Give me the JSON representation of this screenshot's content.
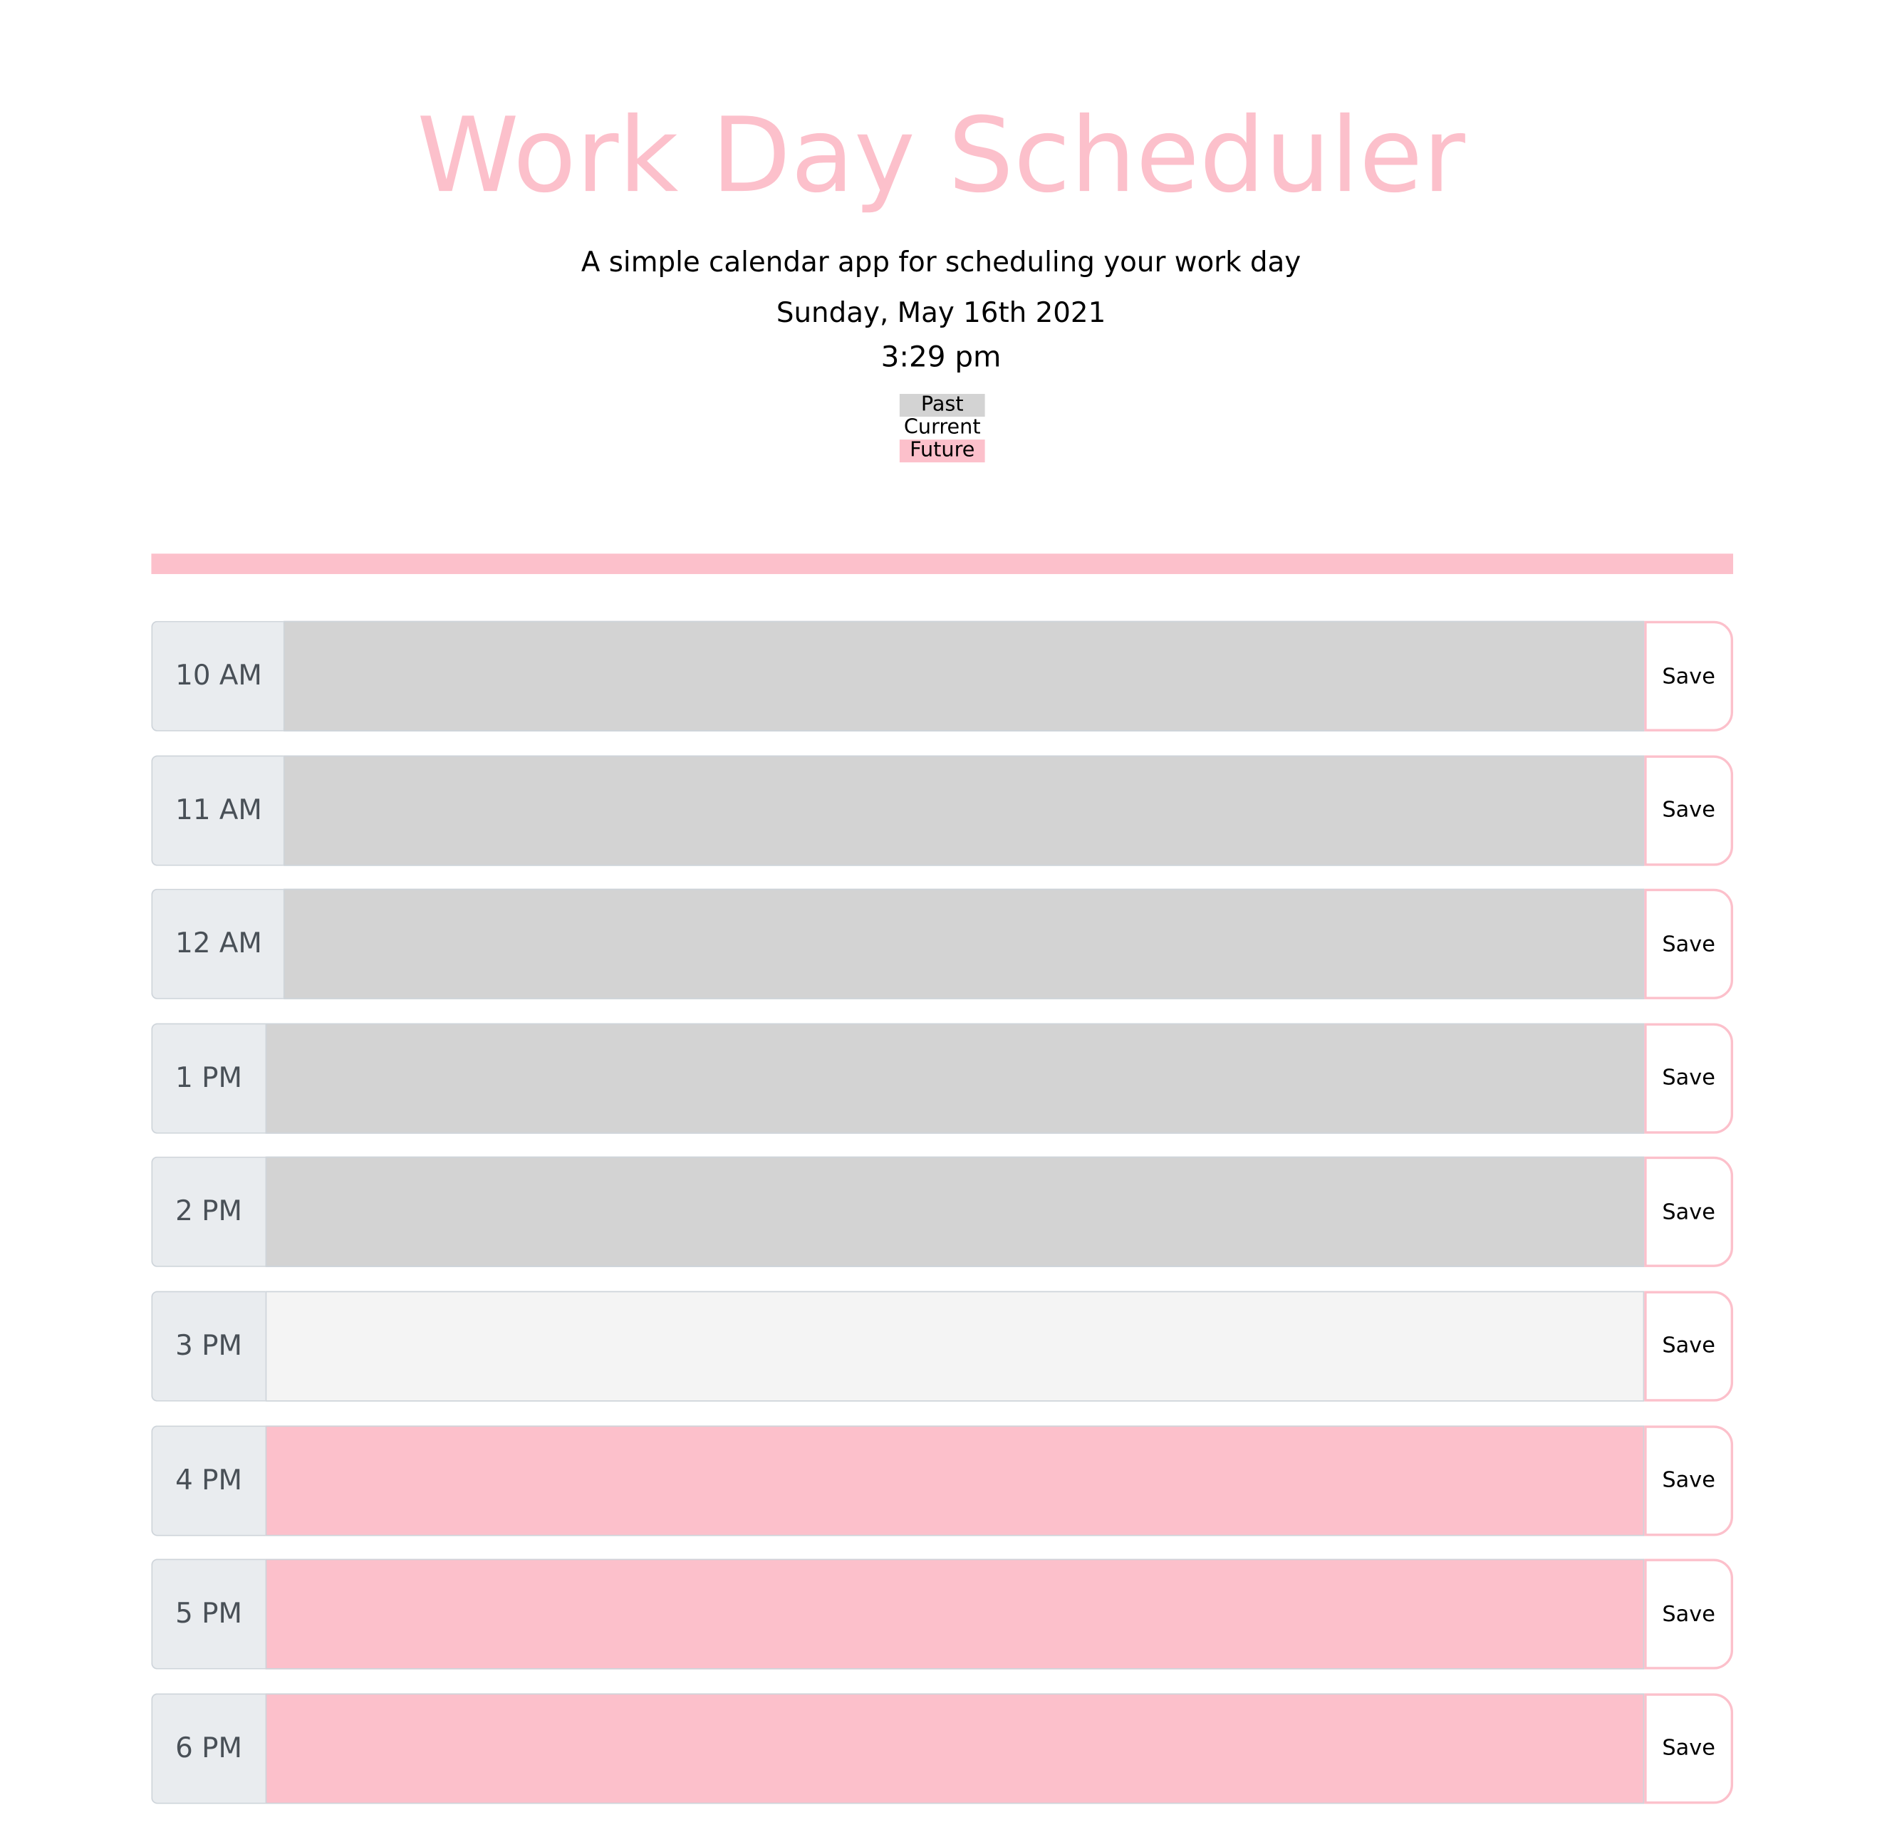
{
  "header": {
    "title": "Work Day Scheduler",
    "subtitle": "A simple calendar app for scheduling your work day",
    "date": "Sunday, May 16th 2021",
    "time": "3:29 pm"
  },
  "legend": [
    {
      "label": "Past",
      "color": "#d3d3d3"
    },
    {
      "label": "Current",
      "color": "#ffffff"
    },
    {
      "label": "Future",
      "color": "#fcc0cb"
    }
  ],
  "colors": {
    "accent": "#fcc0cb",
    "past": "#d3d3d3",
    "present": "#f4f4f4",
    "future": "#fcc0cb"
  },
  "rows": [
    {
      "hour": "10 AM",
      "status": "past",
      "text": "",
      "save_label": "Save"
    },
    {
      "hour": "11 AM",
      "status": "past",
      "text": "",
      "save_label": "Save"
    },
    {
      "hour": "12 AM",
      "status": "past",
      "text": "",
      "save_label": "Save"
    },
    {
      "hour": "1 PM",
      "status": "past",
      "text": "",
      "save_label": "Save"
    },
    {
      "hour": "2 PM",
      "status": "past",
      "text": "",
      "save_label": "Save"
    },
    {
      "hour": "3 PM",
      "status": "present",
      "text": "",
      "save_label": "Save"
    },
    {
      "hour": "4 PM",
      "status": "future",
      "text": "",
      "save_label": "Save"
    },
    {
      "hour": "5 PM",
      "status": "future",
      "text": "",
      "save_label": "Save"
    },
    {
      "hour": "6 PM",
      "status": "future",
      "text": "",
      "save_label": "Save"
    }
  ]
}
